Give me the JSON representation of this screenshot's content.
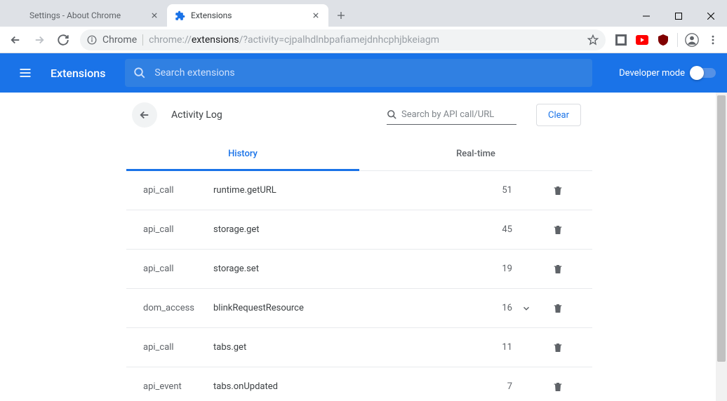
{
  "window": {
    "tabs": [
      {
        "title": "Settings - About Chrome",
        "active": false
      },
      {
        "title": "Extensions",
        "active": true
      }
    ]
  },
  "omnibox": {
    "origin_label": "Chrome",
    "url_prefix": "chrome://",
    "url_bold": "extensions",
    "url_suffix": "/?activity=cjpalhdlnbpafiamejdnhcphjbkeiagm"
  },
  "header": {
    "title": "Extensions",
    "search_placeholder": "Search extensions",
    "devmode_label": "Developer mode"
  },
  "panel": {
    "title": "Activity Log",
    "search_placeholder": "Search by API call/URL",
    "clear_label": "Clear",
    "tabs": [
      {
        "label": "History",
        "active": true
      },
      {
        "label": "Real-time",
        "active": false
      }
    ]
  },
  "log": [
    {
      "type": "api_call",
      "name": "runtime.getURL",
      "count": 51,
      "expandable": false
    },
    {
      "type": "api_call",
      "name": "storage.get",
      "count": 45,
      "expandable": false
    },
    {
      "type": "api_call",
      "name": "storage.set",
      "count": 19,
      "expandable": false
    },
    {
      "type": "dom_access",
      "name": "blinkRequestResource",
      "count": 16,
      "expandable": true
    },
    {
      "type": "api_call",
      "name": "tabs.get",
      "count": 11,
      "expandable": false
    },
    {
      "type": "api_event",
      "name": "tabs.onUpdated",
      "count": 7,
      "expandable": false
    }
  ]
}
